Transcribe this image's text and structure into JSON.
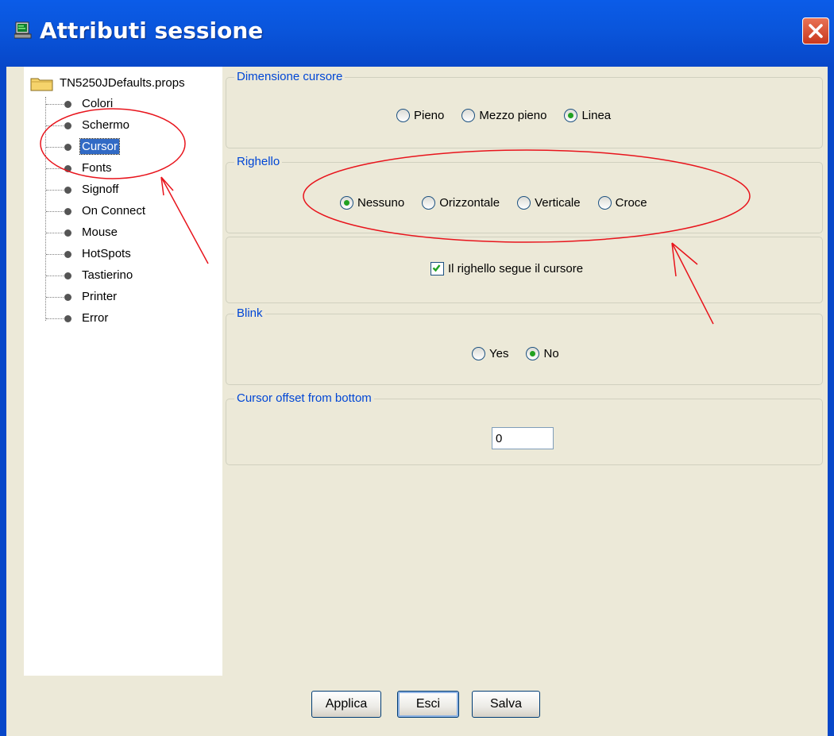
{
  "window": {
    "title": "Attributi sessione",
    "icon": "terminal-icon",
    "close_icon": "close-icon"
  },
  "tree": {
    "root_label": "TN5250JDefaults.props",
    "items": [
      {
        "label": "Colori"
      },
      {
        "label": "Schermo"
      },
      {
        "label": "Cursor"
      },
      {
        "label": "Fonts"
      },
      {
        "label": "Signoff"
      },
      {
        "label": "On Connect"
      },
      {
        "label": "Mouse"
      },
      {
        "label": "HotSpots"
      },
      {
        "label": "Tastierino"
      },
      {
        "label": "Printer"
      },
      {
        "label": "Error"
      }
    ],
    "selected": "Cursor"
  },
  "cursor_size": {
    "title": "Dimensione cursore",
    "options": [
      "Pieno",
      "Mezzo pieno",
      "Linea"
    ],
    "selected": "Linea"
  },
  "ruler": {
    "title": "Righello",
    "options": [
      "Nessuno",
      "Orizzontale",
      "Verticale",
      "Croce"
    ],
    "selected": "Nessuno",
    "follow_cursor_label": "Il righello segue il cursore",
    "follow_cursor_checked": true
  },
  "blink": {
    "title": "Blink",
    "options": [
      "Yes",
      "No"
    ],
    "selected": "No"
  },
  "offset": {
    "title": "Cursor offset from bottom",
    "value": "0"
  },
  "buttons": {
    "apply": "Applica",
    "exit": "Esci",
    "save": "Salva"
  },
  "colors": {
    "title_bar": "#0a55db",
    "dialog_bg": "#ece9d8",
    "group_title": "#0046d5",
    "selection": "#316ac5",
    "annotation": "#e8141c",
    "radio_dot": "#21a121"
  }
}
